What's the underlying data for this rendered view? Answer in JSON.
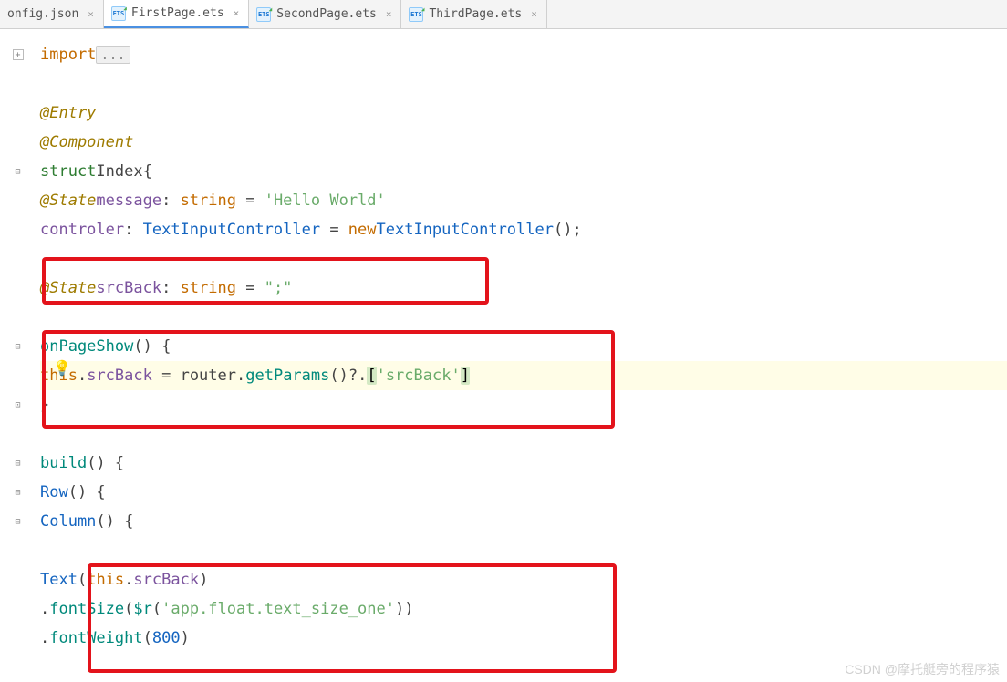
{
  "tabs": [
    {
      "label": "onfig.json",
      "hasIcon": false
    },
    {
      "label": "FirstPage.ets",
      "hasIcon": true,
      "active": true
    },
    {
      "label": "SecondPage.ets",
      "hasIcon": true
    },
    {
      "label": "ThirdPage.ets",
      "hasIcon": true
    }
  ],
  "code": {
    "importKw": "import",
    "fold": "...",
    "entry": "@Entry",
    "component": "@Component",
    "structKw": "struct",
    "structName": "Index",
    "stateDec1": "@State",
    "msgName": "message",
    "stringT": "string",
    "helloStr": "'Hello World'",
    "controler": "controler",
    "tic": "TextInputController",
    "newKw": "new",
    "stateDec2": "@State",
    "srcBack": "srcBack",
    "emptyStr": "\";\"",
    "onPageShow": "onPageShow",
    "thisKw": "this",
    "router": "router",
    "getParams": "getParams",
    "srcBackStr": "'srcBack'",
    "build": "build",
    "row": "Row",
    "column": "Column",
    "text": "Text",
    "fontSize": "fontSize",
    "fontSizeArg": "'app.float.text_size_one'",
    "dollarR": "$r",
    "fontWeight": "fontWeight",
    "fw800": "800"
  },
  "watermark": "CSDN @摩托艇旁的程序猿"
}
